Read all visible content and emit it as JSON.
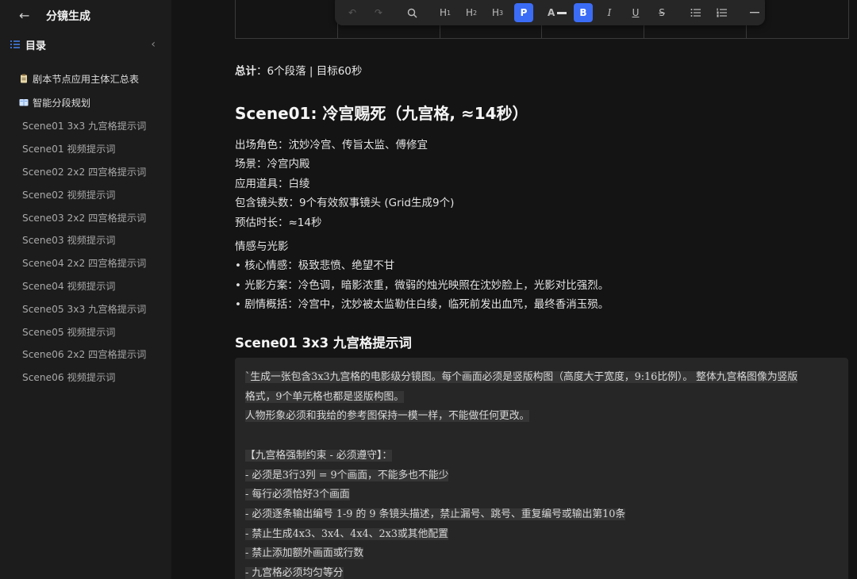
{
  "app": {
    "title": "分镜生成"
  },
  "toc": {
    "label": "目录",
    "items": [
      {
        "label": "剧本节点应用主体汇总表",
        "level": 1,
        "icon": "clipboard-icon"
      },
      {
        "label": "智能分段规划",
        "level": 1,
        "icon": "book-icon"
      },
      {
        "label": "Scene01 3x3 九宫格提示词",
        "level": 2
      },
      {
        "label": "Scene01 视频提示词",
        "level": 2
      },
      {
        "label": "Scene02 2x2 四宫格提示词",
        "level": 2
      },
      {
        "label": "Scene02 视频提示词",
        "level": 2
      },
      {
        "label": "Scene03 2x2 四宫格提示词",
        "level": 2
      },
      {
        "label": "Scene03 视频提示词",
        "level": 2
      },
      {
        "label": "Scene04 2x2 四宫格提示词",
        "level": 2
      },
      {
        "label": "Scene04 视频提示词",
        "level": 2
      },
      {
        "label": "Scene05 3x3 九宫格提示词",
        "level": 2
      },
      {
        "label": "Scene05 视频提示词",
        "level": 2
      },
      {
        "label": "Scene06 2x2 四宫格提示词",
        "level": 2
      },
      {
        "label": "Scene06 视频提示词",
        "level": 2
      }
    ]
  },
  "toolbar": {
    "h1": "H",
    "h2": "H",
    "h3": "H",
    "p": "P",
    "h1_sub": "1",
    "h2_sub": "2",
    "h3_sub": "3",
    "font_color": "A",
    "bold": "B",
    "italic": "I",
    "underline": "U",
    "strike": "S",
    "accent": "#3b6cf6"
  },
  "doc": {
    "summary_label": "总计",
    "summary_value": "：6个段落 | 目标60秒",
    "scene_title": "Scene01: 冷宫赐死（九宫格, ≈14秒）",
    "meta": [
      "出场角色：沈妙冷宫、传旨太监、傅修宜",
      "场景：冷宫内殿",
      "应用道具：白绫",
      "包含镜头数：9个有效叙事镜头 (Grid生成9个)",
      "预估时长：≈14秒"
    ],
    "emotion": [
      "情感与光影",
      "• 核心情感：极致悲愤、绝望不甘",
      "• 光影方案：冷色调，暗影浓重，微弱的烛光映照在沈妙脸上，光影对比强烈。",
      "• 剧情概括：冷宫中，沈妙被太监勒住白绫，临死前发出血咒，最终香消玉殒。"
    ],
    "prompt_title": "Scene01 3x3 九宫格提示词",
    "code_lines": [
      "`生成一张包含3x3九宫格的电影级分镜图。每个画面必须是竖版构图（高度大于宽度，9:16比例）。 整体九宫格图像为竖版",
      "格式，9个单元格也都是竖版构图。",
      "人物形象必须和我给的参考图保持一模一样，不能做任何更改。",
      "",
      "【九宫格强制约束 - 必须遵守】：",
      "- 必须是3行3列 = 9个画面，不能多也不能少",
      "- 每行必须恰好3个画面",
      "- 必须逐条输出编号 1-9 的 9 条镜头描述，禁止漏号、跳号、重复编号或输出第10条",
      "- 禁止生成4x3、3x4、4x4、2x3或其他配置",
      "- 禁止添加额外画面或行数",
      "- 九宫格必须均匀等分"
    ]
  }
}
